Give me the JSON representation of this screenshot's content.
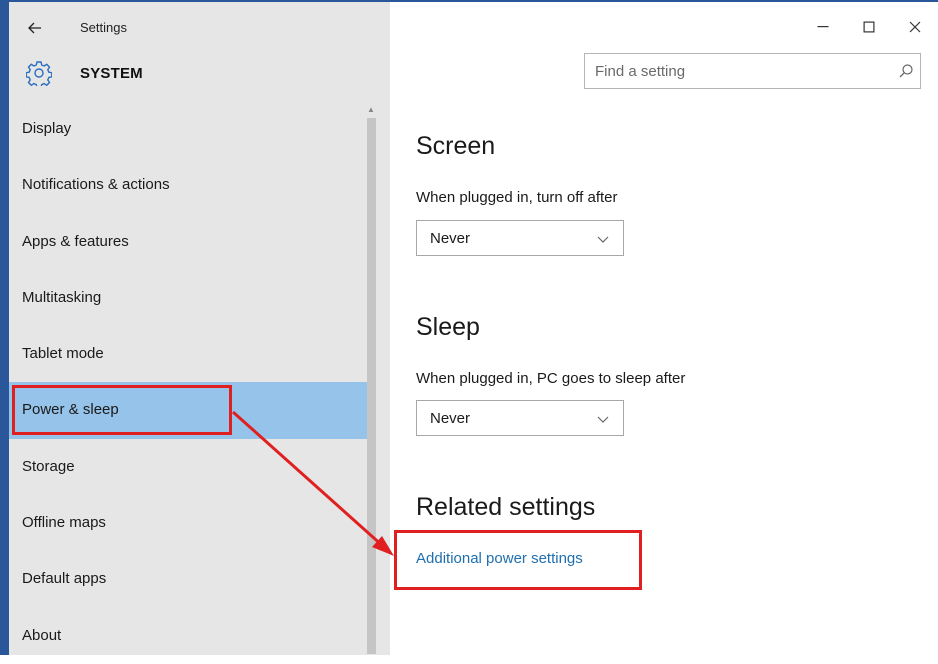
{
  "window": {
    "title": "Settings",
    "controls": [
      "minimize-icon",
      "maximize-icon",
      "close-icon"
    ]
  },
  "header": {
    "icon": "gear-icon",
    "title": "SYSTEM"
  },
  "search": {
    "placeholder": "Find a setting",
    "value": "",
    "icon": "search-icon"
  },
  "sidebar": {
    "items": [
      {
        "label": "Display"
      },
      {
        "label": "Notifications & actions"
      },
      {
        "label": "Apps & features"
      },
      {
        "label": "Multitasking"
      },
      {
        "label": "Tablet mode"
      },
      {
        "label": "Power & sleep",
        "selected": true
      },
      {
        "label": "Storage"
      },
      {
        "label": "Offline maps"
      },
      {
        "label": "Default apps"
      },
      {
        "label": "About"
      }
    ]
  },
  "main": {
    "screen": {
      "title": "Screen",
      "label": "When plugged in, turn off after",
      "value": "Never"
    },
    "sleep": {
      "title": "Sleep",
      "label": "When plugged in, PC goes to sleep after",
      "value": "Never"
    },
    "related": {
      "title": "Related settings",
      "link": "Additional power settings"
    }
  },
  "colors": {
    "accent": "#2a579a",
    "selected_bg": "#95c3e9",
    "sidebar_bg": "#e6e6e6",
    "link": "#1f6fb0",
    "annotation": "#e02020"
  }
}
